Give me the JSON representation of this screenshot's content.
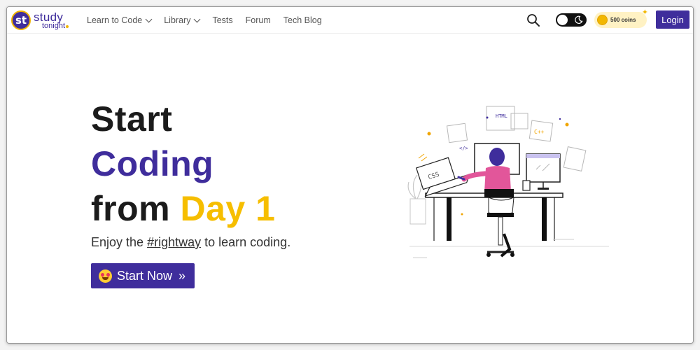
{
  "brand": {
    "badge": "st",
    "name_top": "study",
    "name_bottom": "tonight"
  },
  "nav": {
    "items": [
      {
        "label": "Learn to Code",
        "has_dropdown": true
      },
      {
        "label": "Library",
        "has_dropdown": true
      },
      {
        "label": "Tests",
        "has_dropdown": false
      },
      {
        "label": "Forum",
        "has_dropdown": false
      },
      {
        "label": "Tech Blog",
        "has_dropdown": false
      }
    ],
    "coins_label": "500 coins",
    "login_label": "Login",
    "icons": [
      "search-icon",
      "moon-icon",
      "coin-icon",
      "chevron-down-icon"
    ]
  },
  "hero": {
    "line1": "Start",
    "line2": "Coding",
    "line3_a": "from ",
    "line3_b": "Day 1",
    "subtitle_pre": "Enjoy the ",
    "subtitle_link": "#rightway",
    "subtitle_post": " to learn coding.",
    "cta_label": "Start Now",
    "cta_icons": [
      "heart-eyes-emoji-icon",
      "double-chevron-right-icon"
    ]
  },
  "illustration": {
    "labels": [
      "HTML",
      "C++",
      "CSS",
      "</>"
    ]
  },
  "colors": {
    "brand_purple": "#3f2d9c",
    "accent_yellow": "#f6be00",
    "text_dark": "#1b1b1b",
    "coin_bg": "#fff2c4"
  }
}
